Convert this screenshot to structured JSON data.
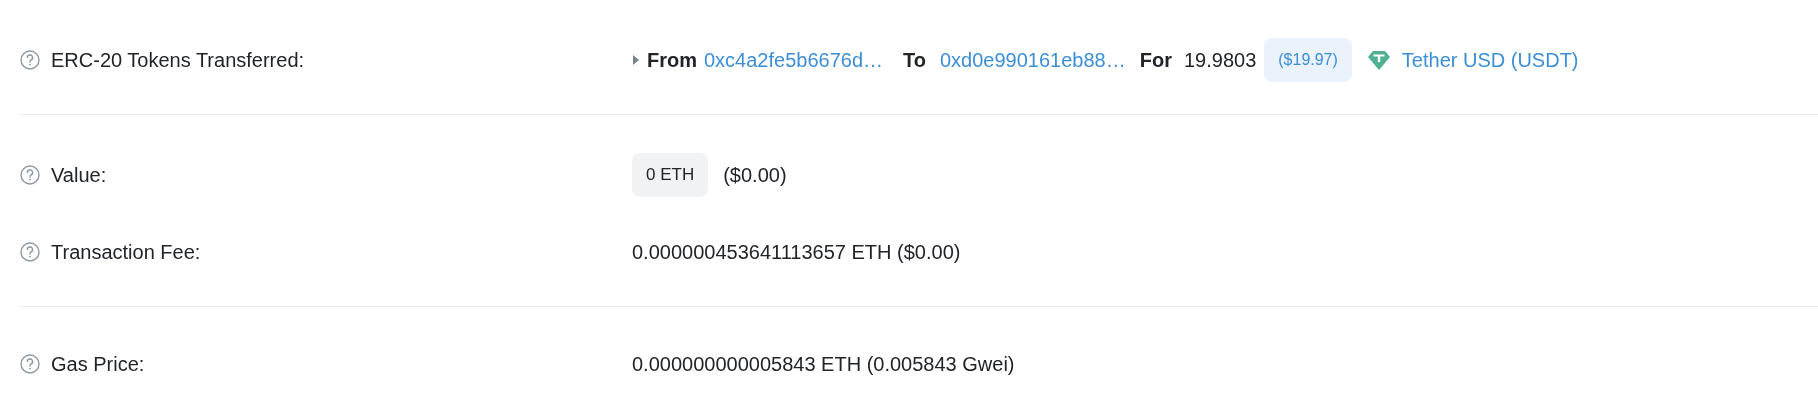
{
  "sections": [
    {
      "rows": [
        {
          "kind": "transfer",
          "label": "ERC-20 Tokens Transferred:",
          "expanded": false,
          "from_label": "From",
          "from": "0xc4a2fe5b6676d…",
          "to_label": "To",
          "to": "0xd0e990161eb88…",
          "for_label": "For",
          "amount": "19.9803",
          "usd": "($19.97)",
          "token": "Tether USD (USDT)"
        }
      ]
    },
    {
      "rows": [
        {
          "kind": "badge",
          "label": "Value:",
          "badge": "0 ETH",
          "text": "($0.00)"
        },
        {
          "kind": "text",
          "label": "Transaction Fee:",
          "text": "0.000000453641113657 ETH ($0.00)"
        }
      ]
    },
    {
      "rows": [
        {
          "kind": "text",
          "label": "Gas Price:",
          "text": "0.000000000005843 ETH (0.005843 Gwei)"
        }
      ]
    }
  ]
}
